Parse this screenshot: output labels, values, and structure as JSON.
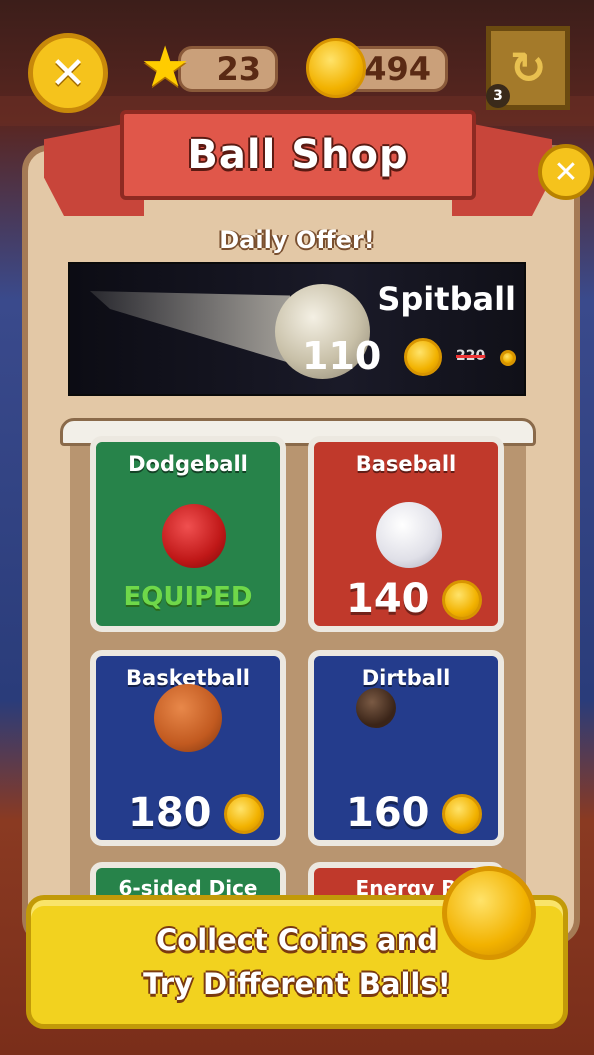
{
  "hud": {
    "stars": "23",
    "coins": "494",
    "refresh_count": "3",
    "close_glyph": "✕",
    "refresh_glyph": "↻",
    "star_glyph": "★"
  },
  "shop": {
    "title": "Ball Shop",
    "close_glyph": "✕",
    "daily_label": "Daily Offer!",
    "offer": {
      "name": "Spitball",
      "price": "110",
      "old_price": "220"
    },
    "items": [
      {
        "name": "Dodgeball",
        "status": "EQUIPED",
        "color": "#27834a"
      },
      {
        "name": "Baseball",
        "price": "140",
        "color": "#c0392b"
      },
      {
        "name": "Basketball",
        "price": "180",
        "color": "#243c8c"
      },
      {
        "name": "Dirtball",
        "price": "160",
        "color": "#243c8c"
      }
    ],
    "partial_items": [
      "6-sided Dice",
      "Energy B"
    ]
  },
  "footer": {
    "line1": "Collect Coins and",
    "line2": "Try Different Balls!"
  }
}
